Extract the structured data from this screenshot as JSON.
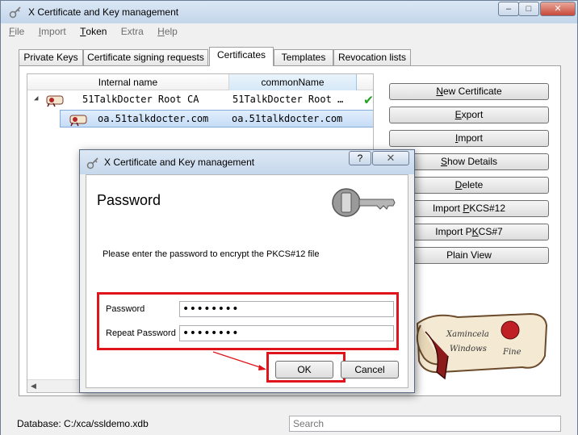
{
  "main": {
    "title": "X Certificate and Key management",
    "window_controls": {
      "minimize": "–",
      "maximize": "□",
      "close": "✕"
    },
    "menu": [
      {
        "label": "File",
        "accel": "F",
        "rest": "ile",
        "enabled": false
      },
      {
        "label": "Import",
        "accel": "I",
        "rest": "mport",
        "enabled": false
      },
      {
        "label": "Token",
        "accel": "T",
        "rest": "oken",
        "enabled": true
      },
      {
        "label": "Extra",
        "accel": "",
        "rest": "Extra",
        "enabled": false
      },
      {
        "label": "Help",
        "accel": "H",
        "rest": "elp",
        "enabled": false
      }
    ],
    "tabs": [
      "Private Keys",
      "Certificate signing requests",
      "Certificates",
      "Templates",
      "Revocation lists"
    ],
    "active_tab": "Certificates",
    "tree": {
      "columns": [
        "Internal name",
        "commonName"
      ],
      "rows": [
        {
          "name": "51TalkDocter Root CA",
          "cn": "51TalkDocter Root …",
          "trusted": "✔"
        },
        {
          "name": "oa.51talkdocter.com",
          "cn": "oa.51talkdocter.com"
        }
      ]
    },
    "buttons": [
      {
        "pre": "",
        "accel": "N",
        "post": "ew Certificate"
      },
      {
        "pre": "",
        "accel": "E",
        "post": "xport"
      },
      {
        "pre": "",
        "accel": "I",
        "post": "mport"
      },
      {
        "pre": "",
        "accel": "S",
        "post": "how Details"
      },
      {
        "pre": "",
        "accel": "D",
        "post": "elete"
      },
      {
        "pre": "Import ",
        "accel": "P",
        "post": "KCS#12"
      },
      {
        "pre": "Import P",
        "accel": "K",
        "post": "CS#7"
      },
      {
        "pre": "Plain View",
        "accel": "",
        "post": ""
      }
    ],
    "database_label": "Database: C:/xca/ssldemo.xdb",
    "search_placeholder": "Search"
  },
  "dialog": {
    "title": "X Certificate and Key management",
    "help_label": "?",
    "close_label": "✕",
    "heading": "Password",
    "message": "Please enter the password to encrypt the PKCS#12 file",
    "password_label": "Password",
    "password_value": "••••••••",
    "repeat_label": "Repeat Password",
    "repeat_value": "••••••••",
    "ok_label": "OK",
    "cancel_label": "Cancel"
  },
  "colors": {
    "highlight": "#e0141b",
    "selection": "#c6dcf6",
    "check": "#2aa12a"
  }
}
